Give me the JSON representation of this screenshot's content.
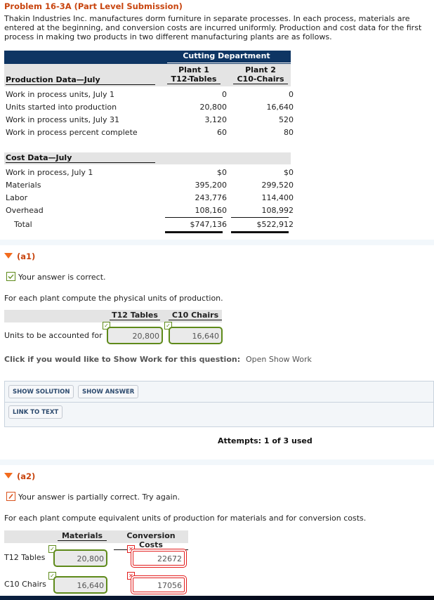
{
  "problem": {
    "title": "Problem 16-3A (Part Level Submission)",
    "intro": "Thakin Industries Inc. manufactures dorm furniture in separate processes. In each process, materials are entered at the beginning, and conversion costs are incurred uniformly. Production and cost data for the first process in making two products in two different manufacturing plants are as follows."
  },
  "data_table": {
    "department": "Cutting Department",
    "plant1_line1": "Plant 1",
    "plant1_line2": "T12-Tables",
    "plant2_line1": "Plant 2",
    "plant2_line2": "C10-Chairs",
    "production_header": "Production Data—July",
    "production_rows": [
      {
        "label": "Work in process units, July 1",
        "plant1": "0",
        "plant2": "0"
      },
      {
        "label": "Units started into production",
        "plant1": "20,800",
        "plant2": "16,640"
      },
      {
        "label": "Work in process units, July 31",
        "plant1": "3,120",
        "plant2": "520"
      },
      {
        "label": "Work in process percent complete",
        "plant1": "60",
        "plant2": "80"
      }
    ],
    "cost_header": "Cost Data—July",
    "cost_rows": [
      {
        "label": "Work in process, July 1",
        "plant1": "$0",
        "plant2": "$0"
      },
      {
        "label": "Materials",
        "plant1": "395,200",
        "plant2": "299,520"
      },
      {
        "label": "Labor",
        "plant1": "243,776",
        "plant2": "114,400"
      },
      {
        "label": "Overhead",
        "plant1": "108,160",
        "plant2": "108,992"
      }
    ],
    "total": {
      "label": "Total",
      "plant1": "$747,136",
      "plant2": "$522,912"
    }
  },
  "part_a1": {
    "label": "(a1)",
    "status": "Your answer is correct.",
    "question": "For each plant compute the physical units of production.",
    "col1": "T12 Tables",
    "col2": "C10 Chairs",
    "row_label": "Units to be accounted for",
    "value1": "20,800",
    "value2": "16,640",
    "show_work_prompt": "Click if you would like to Show Work for this question:",
    "open_show_work": "Open Show Work",
    "buttons": {
      "show_solution": "SHOW SOLUTION",
      "show_answer": "SHOW ANSWER",
      "link_to_text": "LINK TO TEXT"
    },
    "attempts": "Attempts: 1 of 3 used"
  },
  "part_a2": {
    "label": "(a2)",
    "status": "Your answer is partially correct.  Try again.",
    "question": "For each plant compute equivalent units of production for materials and for conversion costs.",
    "col1": "Materials",
    "col2": "Conversion Costs",
    "rows": [
      {
        "label": "T12 Tables",
        "materials": "20,800",
        "conversion": "22672",
        "materials_correct": true,
        "conversion_correct": false
      },
      {
        "label": "C10 Chairs",
        "materials": "16,640",
        "conversion": "17056",
        "materials_correct": true,
        "conversion_correct": false
      }
    ]
  },
  "colors": {
    "accent_orange": "#c8450f",
    "table_header_navy": "#0e3563",
    "correct_green": "#5e8a1a",
    "incorrect_red": "#e21c1c"
  }
}
